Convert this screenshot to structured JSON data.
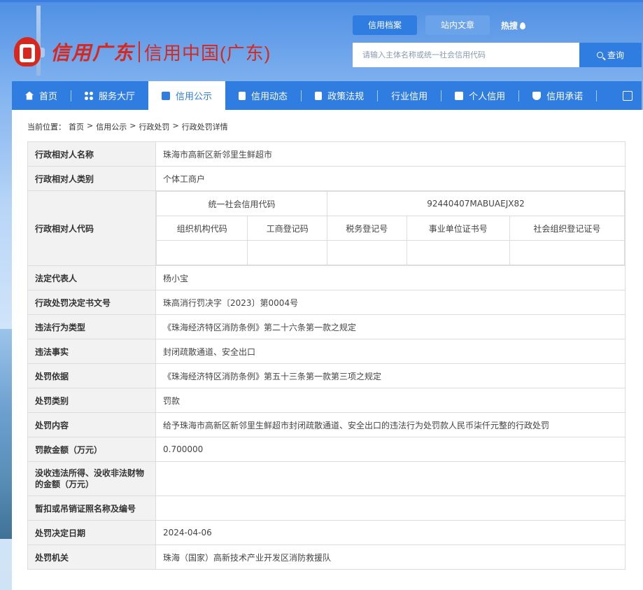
{
  "brand": {
    "script_text": "信用广东",
    "name": "信用中国(广东)"
  },
  "top_tabs": [
    {
      "label": "信用档案",
      "active": true
    },
    {
      "label": "站内文章",
      "active": false
    }
  ],
  "hot_search": "热搜",
  "search": {
    "placeholder": "请输入主体名称或统一社会信用代码",
    "button": "查询"
  },
  "nav": [
    {
      "label": "首页",
      "icon": "home-icon",
      "active": false
    },
    {
      "label": "服务大厅",
      "icon": "grid-icon",
      "active": false
    },
    {
      "label": "信用公示",
      "icon": "briefcase-icon",
      "active": true
    },
    {
      "label": "信用动态",
      "icon": "document-icon",
      "active": false
    },
    {
      "label": "政策法规",
      "icon": "book-icon",
      "active": false
    },
    {
      "label": "行业信用",
      "icon": "building-icon",
      "active": false
    },
    {
      "label": "个人信用",
      "icon": "id-card-icon",
      "active": false
    },
    {
      "label": "信用承诺",
      "icon": "shield-icon",
      "active": false
    }
  ],
  "breadcrumb": {
    "prefix": "当前位置：",
    "items": [
      "首页",
      "信用公示",
      "行政处罚",
      "行政处罚详情"
    ],
    "sep": ">"
  },
  "detail": {
    "subject_name_label": "行政相对人名称",
    "subject_name": "珠海市高新区新邻里生鲜超市",
    "subject_type_label": "行政相对人类别",
    "subject_type": "个体工商户",
    "code_label": "行政相对人代码",
    "uscc_label": "统一社会信用代码",
    "uscc_value": "92440407MABUAEJX82",
    "code_headers": [
      "组织机构代码",
      "工商登记码",
      "税务登记号",
      "事业单位证书号",
      "社会组织登记证号"
    ],
    "code_values": [
      "",
      "",
      "",
      "",
      ""
    ],
    "rows": [
      {
        "label": "法定代表人",
        "value": "杨小宝"
      },
      {
        "label": "行政处罚决定书文号",
        "value": "珠高消行罚决字〔2023〕第0004号"
      },
      {
        "label": "违法行为类型",
        "value": "《珠海经济特区消防条例》第二十六条第一款之规定"
      },
      {
        "label": "违法事实",
        "value": "封闭疏散通道、安全出口"
      },
      {
        "label": "处罚依据",
        "value": "《珠海经济特区消防条例》第五十三条第一款第三项之规定"
      },
      {
        "label": "处罚类别",
        "value": "罚款"
      },
      {
        "label": "处罚内容",
        "value": "给予珠海市高新区新邻里生鲜超市封闭疏散通道、安全出口的违法行为处罚款人民币柒仟元整的行政处罚"
      },
      {
        "label": "罚款金额（万元）",
        "value": "0.700000"
      },
      {
        "label": "没收违法所得、没收非法财物的金额（万元）",
        "value": ""
      },
      {
        "label": "暂扣或吊销证照名称及编号",
        "value": ""
      },
      {
        "label": "处罚决定日期",
        "value": "2024-04-06"
      },
      {
        "label": "处罚机关",
        "value": "珠海（国家）高新技术产业开发区消防救援队"
      }
    ]
  },
  "colors": {
    "primary": "#2f7de1",
    "brand_red": "#d8271c",
    "label_bg": "#f2f2f2"
  }
}
